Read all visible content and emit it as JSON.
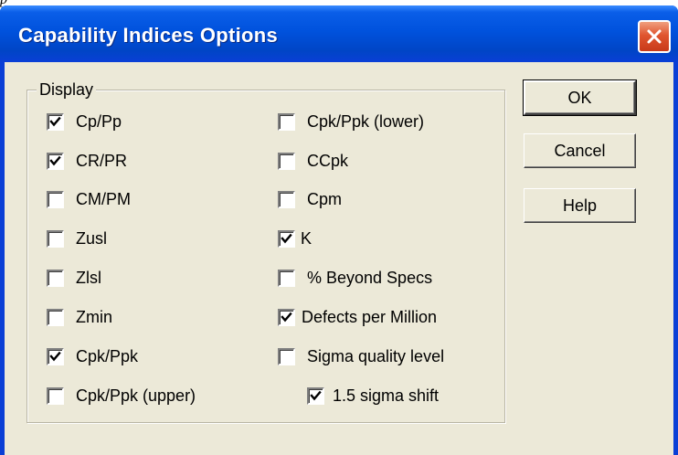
{
  "dialog": {
    "title": "Capability Indices Options",
    "close_icon": "close-icon"
  },
  "display_group": {
    "label": "Display",
    "left_column": [
      {
        "label": "Cp/Pp",
        "checked": true
      },
      {
        "label": "CR/PR",
        "checked": true
      },
      {
        "label": "CM/PM",
        "checked": false
      },
      {
        "label": "Zusl",
        "checked": false
      },
      {
        "label": "Zlsl",
        "checked": false
      },
      {
        "label": "Zmin",
        "checked": false
      },
      {
        "label": "Cpk/Ppk",
        "checked": true
      },
      {
        "label": "Cpk/Ppk (upper)",
        "checked": false
      }
    ],
    "right_column": [
      {
        "label": "Cpk/Ppk (lower)",
        "checked": false
      },
      {
        "label": "CCpk",
        "checked": false
      },
      {
        "label": "Cpm",
        "checked": false
      },
      {
        "label": "K",
        "checked": true
      },
      {
        "label": "% Beyond Specs",
        "checked": false
      },
      {
        "label": "Defects per Million",
        "checked": true
      },
      {
        "label": "Sigma quality level",
        "checked": false
      },
      {
        "label": "1.5 sigma shift",
        "checked": true
      }
    ]
  },
  "buttons": {
    "ok": "OK",
    "cancel": "Cancel",
    "help": "Help"
  },
  "colors": {
    "titlebar": "#0052dd",
    "dialog_face": "#ece9d8",
    "close_button": "#e0552f"
  }
}
